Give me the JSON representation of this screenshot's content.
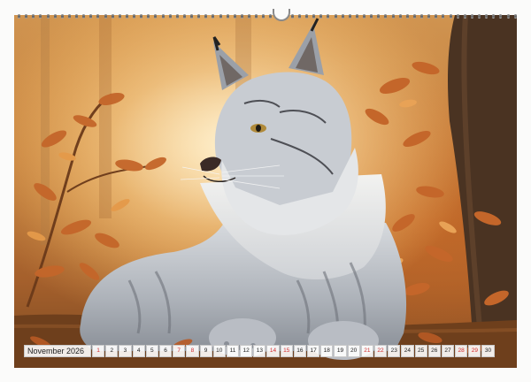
{
  "binding": {
    "ring_count": 70
  },
  "photo": {
    "subject": "lynx-in-autumn-forest",
    "colors": {
      "warm_light": "#f3c27a",
      "leaf": "#c4662a",
      "fur": "#c9cdd3",
      "trunk": "#4a3322"
    }
  },
  "calendar": {
    "month": "November 2026",
    "days": [
      {
        "n": "1",
        "weekend": true
      },
      {
        "n": "2",
        "weekend": false
      },
      {
        "n": "3",
        "weekend": false
      },
      {
        "n": "4",
        "weekend": false
      },
      {
        "n": "5",
        "weekend": false
      },
      {
        "n": "6",
        "weekend": false
      },
      {
        "n": "7",
        "weekend": true
      },
      {
        "n": "8",
        "weekend": true
      },
      {
        "n": "9",
        "weekend": false
      },
      {
        "n": "10",
        "weekend": false
      },
      {
        "n": "11",
        "weekend": false
      },
      {
        "n": "12",
        "weekend": false
      },
      {
        "n": "13",
        "weekend": false
      },
      {
        "n": "14",
        "weekend": true
      },
      {
        "n": "15",
        "weekend": true
      },
      {
        "n": "16",
        "weekend": false
      },
      {
        "n": "17",
        "weekend": false
      },
      {
        "n": "18",
        "weekend": false
      },
      {
        "n": "19",
        "weekend": false
      },
      {
        "n": "20",
        "weekend": false
      },
      {
        "n": "21",
        "weekend": true
      },
      {
        "n": "22",
        "weekend": true
      },
      {
        "n": "23",
        "weekend": false
      },
      {
        "n": "24",
        "weekend": false
      },
      {
        "n": "25",
        "weekend": false
      },
      {
        "n": "26",
        "weekend": false
      },
      {
        "n": "27",
        "weekend": false
      },
      {
        "n": "28",
        "weekend": true
      },
      {
        "n": "29",
        "weekend": true
      },
      {
        "n": "30",
        "weekend": false
      }
    ]
  }
}
